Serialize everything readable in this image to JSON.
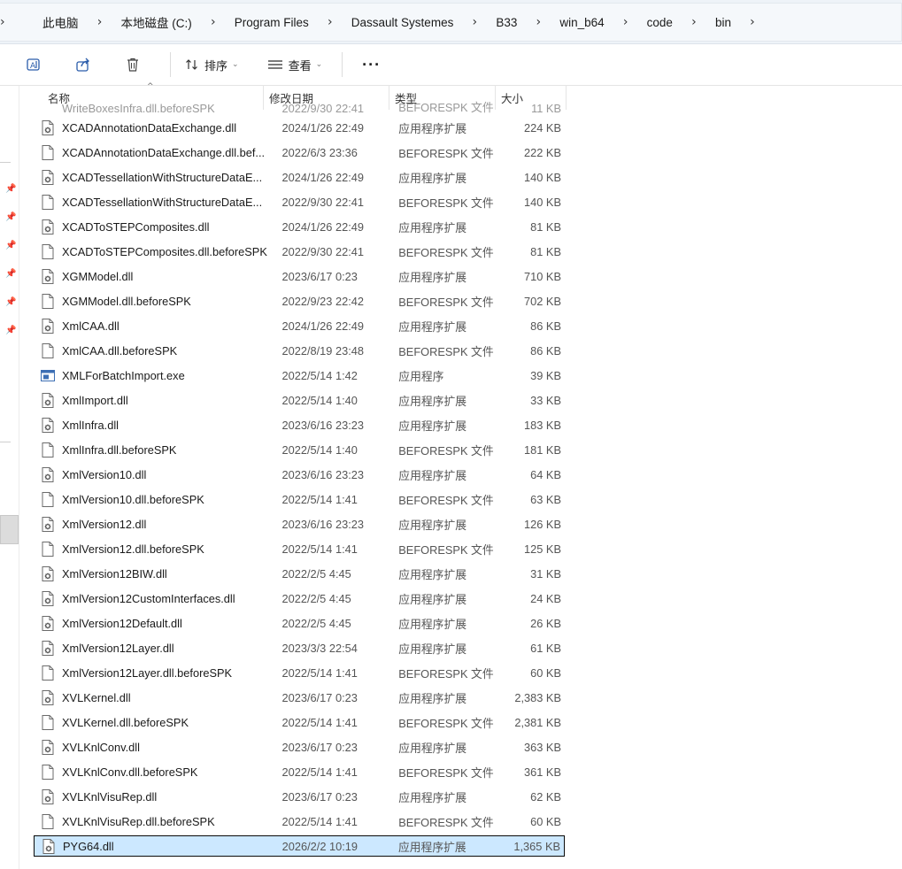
{
  "address_bar": {
    "crumbs": [
      "此电脑",
      "本地磁盘 (C:)",
      "Program Files",
      "Dassault Systemes",
      "B33",
      "win_b64",
      "code",
      "bin"
    ]
  },
  "toolbar": {
    "sort_label": "排序",
    "view_label": "查看",
    "more_label": "···"
  },
  "columns": {
    "name": "名称",
    "date": "修改日期",
    "type": "类型",
    "size": "大小"
  },
  "partial_row": {
    "name": "WriteBoxesInfra.dll.beforeSPK",
    "date": "2022/9/30 22:41",
    "type": "BEFORESPK 文件",
    "size": "11 KB"
  },
  "files": [
    {
      "name": "XCADAnnotationDataExchange.dll",
      "date": "2024/1/26 22:49",
      "type": "应用程序扩展",
      "size": "224 KB",
      "icon": "dll-icon"
    },
    {
      "name": "XCADAnnotationDataExchange.dll.bef...",
      "date": "2022/6/3 23:36",
      "type": "BEFORESPK 文件",
      "size": "222 KB",
      "icon": "file-icon"
    },
    {
      "name": "XCADTessellationWithStructureDataE...",
      "date": "2024/1/26 22:49",
      "type": "应用程序扩展",
      "size": "140 KB",
      "icon": "dll-icon"
    },
    {
      "name": "XCADTessellationWithStructureDataE...",
      "date": "2022/9/30 22:41",
      "type": "BEFORESPK 文件",
      "size": "140 KB",
      "icon": "file-icon"
    },
    {
      "name": "XCADToSTEPComposites.dll",
      "date": "2024/1/26 22:49",
      "type": "应用程序扩展",
      "size": "81 KB",
      "icon": "dll-icon"
    },
    {
      "name": "XCADToSTEPComposites.dll.beforeSPK",
      "date": "2022/9/30 22:41",
      "type": "BEFORESPK 文件",
      "size": "81 KB",
      "icon": "file-icon"
    },
    {
      "name": "XGMModel.dll",
      "date": "2023/6/17 0:23",
      "type": "应用程序扩展",
      "size": "710 KB",
      "icon": "dll-icon"
    },
    {
      "name": "XGMModel.dll.beforeSPK",
      "date": "2022/9/23 22:42",
      "type": "BEFORESPK 文件",
      "size": "702 KB",
      "icon": "file-icon"
    },
    {
      "name": "XmlCAA.dll",
      "date": "2024/1/26 22:49",
      "type": "应用程序扩展",
      "size": "86 KB",
      "icon": "dll-icon"
    },
    {
      "name": "XmlCAA.dll.beforeSPK",
      "date": "2022/8/19 23:48",
      "type": "BEFORESPK 文件",
      "size": "86 KB",
      "icon": "file-icon"
    },
    {
      "name": "XMLForBatchImport.exe",
      "date": "2022/5/14 1:42",
      "type": "应用程序",
      "size": "39 KB",
      "icon": "exe-icon"
    },
    {
      "name": "XmlImport.dll",
      "date": "2022/5/14 1:40",
      "type": "应用程序扩展",
      "size": "33 KB",
      "icon": "dll-icon"
    },
    {
      "name": "XmlInfra.dll",
      "date": "2023/6/16 23:23",
      "type": "应用程序扩展",
      "size": "183 KB",
      "icon": "dll-icon"
    },
    {
      "name": "XmlInfra.dll.beforeSPK",
      "date": "2022/5/14 1:40",
      "type": "BEFORESPK 文件",
      "size": "181 KB",
      "icon": "file-icon"
    },
    {
      "name": "XmlVersion10.dll",
      "date": "2023/6/16 23:23",
      "type": "应用程序扩展",
      "size": "64 KB",
      "icon": "dll-icon"
    },
    {
      "name": "XmlVersion10.dll.beforeSPK",
      "date": "2022/5/14 1:41",
      "type": "BEFORESPK 文件",
      "size": "63 KB",
      "icon": "file-icon"
    },
    {
      "name": "XmlVersion12.dll",
      "date": "2023/6/16 23:23",
      "type": "应用程序扩展",
      "size": "126 KB",
      "icon": "dll-icon"
    },
    {
      "name": "XmlVersion12.dll.beforeSPK",
      "date": "2022/5/14 1:41",
      "type": "BEFORESPK 文件",
      "size": "125 KB",
      "icon": "file-icon"
    },
    {
      "name": "XmlVersion12BIW.dll",
      "date": "2022/2/5 4:45",
      "type": "应用程序扩展",
      "size": "31 KB",
      "icon": "dll-icon"
    },
    {
      "name": "XmlVersion12CustomInterfaces.dll",
      "date": "2022/2/5 4:45",
      "type": "应用程序扩展",
      "size": "24 KB",
      "icon": "dll-icon"
    },
    {
      "name": "XmlVersion12Default.dll",
      "date": "2022/2/5 4:45",
      "type": "应用程序扩展",
      "size": "26 KB",
      "icon": "dll-icon"
    },
    {
      "name": "XmlVersion12Layer.dll",
      "date": "2023/3/3 22:54",
      "type": "应用程序扩展",
      "size": "61 KB",
      "icon": "dll-icon"
    },
    {
      "name": "XmlVersion12Layer.dll.beforeSPK",
      "date": "2022/5/14 1:41",
      "type": "BEFORESPK 文件",
      "size": "60 KB",
      "icon": "file-icon"
    },
    {
      "name": "XVLKernel.dll",
      "date": "2023/6/17 0:23",
      "type": "应用程序扩展",
      "size": "2,383 KB",
      "icon": "dll-icon"
    },
    {
      "name": "XVLKernel.dll.beforeSPK",
      "date": "2022/5/14 1:41",
      "type": "BEFORESPK 文件",
      "size": "2,381 KB",
      "icon": "file-icon"
    },
    {
      "name": "XVLKnlConv.dll",
      "date": "2023/6/17 0:23",
      "type": "应用程序扩展",
      "size": "363 KB",
      "icon": "dll-icon"
    },
    {
      "name": "XVLKnlConv.dll.beforeSPK",
      "date": "2022/5/14 1:41",
      "type": "BEFORESPK 文件",
      "size": "361 KB",
      "icon": "file-icon"
    },
    {
      "name": "XVLKnlVisuRep.dll",
      "date": "2023/6/17 0:23",
      "type": "应用程序扩展",
      "size": "62 KB",
      "icon": "dll-icon"
    },
    {
      "name": "XVLKnlVisuRep.dll.beforeSPK",
      "date": "2022/5/14 1:41",
      "type": "BEFORESPK 文件",
      "size": "60 KB",
      "icon": "file-icon"
    },
    {
      "name": "PYG64.dll",
      "date": "2026/2/2 10:19",
      "type": "应用程序扩展",
      "size": "1,365 KB",
      "icon": "dll-icon",
      "selected": true
    }
  ],
  "colors": {
    "selection_bg": "#cce8ff",
    "accent": "#2a5caa",
    "address_bg": "#f5f8fb"
  }
}
